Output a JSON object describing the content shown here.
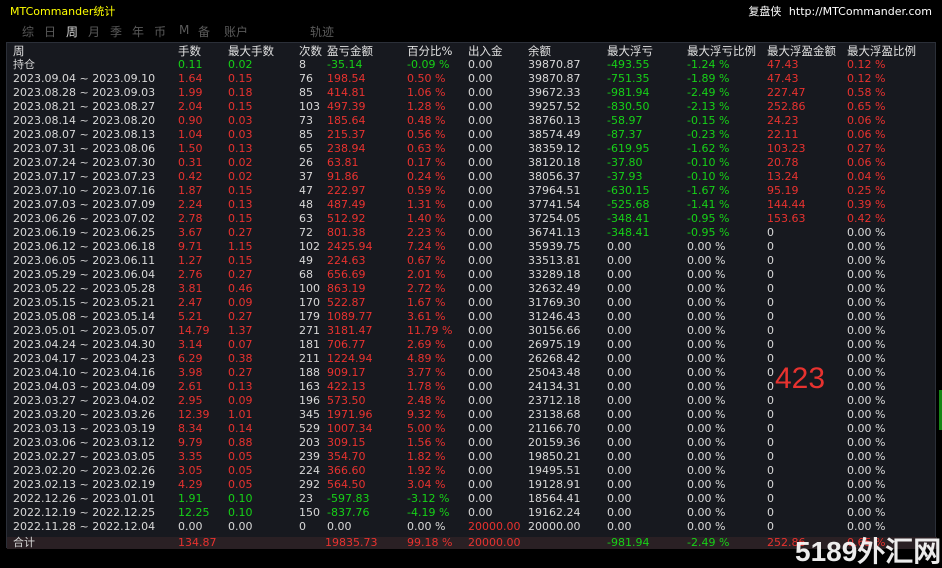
{
  "app": {
    "title": "MTCommander统计",
    "brand_label": "复盘侠",
    "brand_url": "http://MTCommander.com"
  },
  "tabs": [
    {
      "label": "综",
      "active": false
    },
    {
      "label": "日",
      "active": false
    },
    {
      "label": "周",
      "active": true
    },
    {
      "label": "月",
      "active": false
    },
    {
      "label": "季",
      "active": false
    },
    {
      "label": "年",
      "active": false
    },
    {
      "label": "币",
      "active": false
    },
    {
      "label": "M",
      "active": false
    },
    {
      "label": "备",
      "active": false
    },
    {
      "label": "账户",
      "active": false
    },
    {
      "label": "轨迹",
      "active": false
    }
  ],
  "columns": [
    "周",
    "手数",
    "最大手数",
    "次数",
    "盈亏金额",
    "百分比%",
    "出入金",
    "余额",
    "最大浮亏",
    "最大浮亏比例",
    "最大浮盈金额",
    "最大浮盈比例"
  ],
  "rows": [
    {
      "tone": "green",
      "cells": [
        "持仓",
        "0.11",
        "0.02",
        "8",
        "-35.14",
        "-0.09 %",
        "0.00",
        "39870.87",
        "-493.55",
        "-1.24 %",
        "47.43",
        "0.12 %"
      ]
    },
    {
      "tone": "red",
      "cells": [
        "2023.09.04 ~ 2023.09.10",
        "1.64",
        "0.15",
        "76",
        "198.54",
        "0.50 %",
        "0.00",
        "39870.87",
        "-751.35",
        "-1.89 %",
        "47.43",
        "0.12 %"
      ]
    },
    {
      "tone": "red",
      "cells": [
        "2023.08.28 ~ 2023.09.03",
        "1.99",
        "0.18",
        "85",
        "414.81",
        "1.06 %",
        "0.00",
        "39672.33",
        "-981.94",
        "-2.49 %",
        "227.47",
        "0.58 %"
      ]
    },
    {
      "tone": "red",
      "cells": [
        "2023.08.21 ~ 2023.08.27",
        "2.04",
        "0.15",
        "103",
        "497.39",
        "1.28 %",
        "0.00",
        "39257.52",
        "-830.50",
        "-2.13 %",
        "252.86",
        "0.65 %"
      ]
    },
    {
      "tone": "red",
      "cells": [
        "2023.08.14 ~ 2023.08.20",
        "0.90",
        "0.03",
        "73",
        "185.64",
        "0.48 %",
        "0.00",
        "38760.13",
        "-58.97",
        "-0.15 %",
        "24.23",
        "0.06 %"
      ]
    },
    {
      "tone": "red",
      "cells": [
        "2023.08.07 ~ 2023.08.13",
        "1.04",
        "0.03",
        "85",
        "215.37",
        "0.56 %",
        "0.00",
        "38574.49",
        "-87.37",
        "-0.23 %",
        "22.11",
        "0.06 %"
      ]
    },
    {
      "tone": "red",
      "cells": [
        "2023.07.31 ~ 2023.08.06",
        "1.50",
        "0.13",
        "65",
        "238.94",
        "0.63 %",
        "0.00",
        "38359.12",
        "-619.95",
        "-1.62 %",
        "103.23",
        "0.27 %"
      ]
    },
    {
      "tone": "red",
      "cells": [
        "2023.07.24 ~ 2023.07.30",
        "0.31",
        "0.02",
        "26",
        "63.81",
        "0.17 %",
        "0.00",
        "38120.18",
        "-37.80",
        "-0.10 %",
        "20.78",
        "0.06 %"
      ]
    },
    {
      "tone": "red",
      "cells": [
        "2023.07.17 ~ 2023.07.23",
        "0.42",
        "0.02",
        "37",
        "91.86",
        "0.24 %",
        "0.00",
        "38056.37",
        "-37.93",
        "-0.10 %",
        "13.24",
        "0.04 %"
      ]
    },
    {
      "tone": "red",
      "cells": [
        "2023.07.10 ~ 2023.07.16",
        "1.87",
        "0.15",
        "47",
        "222.97",
        "0.59 %",
        "0.00",
        "37964.51",
        "-630.15",
        "-1.67 %",
        "95.19",
        "0.25 %"
      ]
    },
    {
      "tone": "red",
      "cells": [
        "2023.07.03 ~ 2023.07.09",
        "2.24",
        "0.13",
        "48",
        "487.49",
        "1.31 %",
        "0.00",
        "37741.54",
        "-525.68",
        "-1.41 %",
        "144.44",
        "0.39 %"
      ]
    },
    {
      "tone": "red",
      "cells": [
        "2023.06.26 ~ 2023.07.02",
        "2.78",
        "0.15",
        "63",
        "512.92",
        "1.40 %",
        "0.00",
        "37254.05",
        "-348.41",
        "-0.95 %",
        "153.63",
        "0.42 %"
      ]
    },
    {
      "tone": "red",
      "cells": [
        "2023.06.19 ~ 2023.06.25",
        "3.67",
        "0.27",
        "72",
        "801.38",
        "2.23 %",
        "0.00",
        "36741.13",
        "-348.41",
        "-0.95 %",
        "0",
        "0.00 %"
      ]
    },
    {
      "tone": "red",
      "cells": [
        "2023.06.12 ~ 2023.06.18",
        "9.71",
        "1.15",
        "102",
        "2425.94",
        "7.24 %",
        "0.00",
        "35939.75",
        "0.00",
        "0.00 %",
        "0",
        "0.00 %"
      ]
    },
    {
      "tone": "red",
      "cells": [
        "2023.06.05 ~ 2023.06.11",
        "1.27",
        "0.15",
        "49",
        "224.63",
        "0.67 %",
        "0.00",
        "33513.81",
        "0.00",
        "0.00 %",
        "0",
        "0.00 %"
      ]
    },
    {
      "tone": "red",
      "cells": [
        "2023.05.29 ~ 2023.06.04",
        "2.76",
        "0.27",
        "68",
        "656.69",
        "2.01 %",
        "0.00",
        "33289.18",
        "0.00",
        "0.00 %",
        "0",
        "0.00 %"
      ]
    },
    {
      "tone": "red",
      "cells": [
        "2023.05.22 ~ 2023.05.28",
        "3.81",
        "0.46",
        "100",
        "863.19",
        "2.72 %",
        "0.00",
        "32632.49",
        "0.00",
        "0.00 %",
        "0",
        "0.00 %"
      ]
    },
    {
      "tone": "red",
      "cells": [
        "2023.05.15 ~ 2023.05.21",
        "2.47",
        "0.09",
        "170",
        "522.87",
        "1.67 %",
        "0.00",
        "31769.30",
        "0.00",
        "0.00 %",
        "0",
        "0.00 %"
      ]
    },
    {
      "tone": "red",
      "cells": [
        "2023.05.08 ~ 2023.05.14",
        "5.21",
        "0.27",
        "179",
        "1089.77",
        "3.61 %",
        "0.00",
        "31246.43",
        "0.00",
        "0.00 %",
        "0",
        "0.00 %"
      ]
    },
    {
      "tone": "red",
      "cells": [
        "2023.05.01 ~ 2023.05.07",
        "14.79",
        "1.37",
        "271",
        "3181.47",
        "11.79 %",
        "0.00",
        "30156.66",
        "0.00",
        "0.00 %",
        "0",
        "0.00 %"
      ]
    },
    {
      "tone": "red",
      "cells": [
        "2023.04.24 ~ 2023.04.30",
        "3.14",
        "0.07",
        "181",
        "706.77",
        "2.69 %",
        "0.00",
        "26975.19",
        "0.00",
        "0.00 %",
        "0",
        "0.00 %"
      ]
    },
    {
      "tone": "red",
      "cells": [
        "2023.04.17 ~ 2023.04.23",
        "6.29",
        "0.38",
        "211",
        "1224.94",
        "4.89 %",
        "0.00",
        "26268.42",
        "0.00",
        "0.00 %",
        "0",
        "0.00 %"
      ]
    },
    {
      "tone": "red",
      "cells": [
        "2023.04.10 ~ 2023.04.16",
        "3.98",
        "0.27",
        "188",
        "909.17",
        "3.77 %",
        "0.00",
        "25043.48",
        "0.00",
        "0.00 %",
        "0",
        "0.00 %"
      ]
    },
    {
      "tone": "red",
      "cells": [
        "2023.04.03 ~ 2023.04.09",
        "2.61",
        "0.13",
        "163",
        "422.13",
        "1.78 %",
        "0.00",
        "24134.31",
        "0.00",
        "0.00 %",
        "0",
        "0.00 %"
      ]
    },
    {
      "tone": "red",
      "cells": [
        "2023.03.27 ~ 2023.04.02",
        "2.95",
        "0.09",
        "196",
        "573.50",
        "2.48 %",
        "0.00",
        "23712.18",
        "0.00",
        "0.00 %",
        "0",
        "0.00 %"
      ]
    },
    {
      "tone": "red",
      "cells": [
        "2023.03.20 ~ 2023.03.26",
        "12.39",
        "1.01",
        "345",
        "1971.96",
        "9.32 %",
        "0.00",
        "23138.68",
        "0.00",
        "0.00 %",
        "0",
        "0.00 %"
      ]
    },
    {
      "tone": "red",
      "cells": [
        "2023.03.13 ~ 2023.03.19",
        "8.34",
        "0.14",
        "529",
        "1007.34",
        "5.00 %",
        "0.00",
        "21166.70",
        "0.00",
        "0.00 %",
        "0",
        "0.00 %"
      ]
    },
    {
      "tone": "red",
      "cells": [
        "2023.03.06 ~ 2023.03.12",
        "9.79",
        "0.88",
        "203",
        "309.15",
        "1.56 %",
        "0.00",
        "20159.36",
        "0.00",
        "0.00 %",
        "0",
        "0.00 %"
      ]
    },
    {
      "tone": "red",
      "cells": [
        "2023.02.27 ~ 2023.03.05",
        "3.35",
        "0.05",
        "239",
        "354.70",
        "1.82 %",
        "0.00",
        "19850.21",
        "0.00",
        "0.00 %",
        "0",
        "0.00 %"
      ]
    },
    {
      "tone": "red",
      "cells": [
        "2023.02.20 ~ 2023.02.26",
        "3.05",
        "0.05",
        "224",
        "366.60",
        "1.92 %",
        "0.00",
        "19495.51",
        "0.00",
        "0.00 %",
        "0",
        "0.00 %"
      ]
    },
    {
      "tone": "red",
      "cells": [
        "2023.02.13 ~ 2023.02.19",
        "4.29",
        "0.05",
        "292",
        "564.50",
        "3.04 %",
        "0.00",
        "19128.91",
        "0.00",
        "0.00 %",
        "0",
        "0.00 %"
      ]
    },
    {
      "tone": "green",
      "cells": [
        "2022.12.26 ~ 2023.01.01",
        "1.91",
        "0.10",
        "23",
        "-597.83",
        "-3.12 %",
        "0.00",
        "18564.41",
        "0.00",
        "0.00 %",
        "0",
        "0.00 %"
      ]
    },
    {
      "tone": "green",
      "cells": [
        "2022.12.19 ~ 2022.12.25",
        "12.25",
        "0.10",
        "150",
        "-837.76",
        "-4.19 %",
        "0.00",
        "19162.24",
        "0.00",
        "0.00 %",
        "0",
        "0.00 %"
      ]
    },
    {
      "tone": "neutral",
      "cells": [
        "2022.11.28 ~ 2022.12.04",
        "0.00",
        "0.00",
        "0",
        "0.00",
        "0.00 %",
        "20000.00",
        "20000.00",
        "0.00",
        "0.00 %",
        "0",
        "0.00 %"
      ]
    }
  ],
  "total": {
    "label": "合计",
    "lots": "134.87",
    "pnl": "19835.73",
    "pct": "99.18 %",
    "deposit": "20000.00",
    "max_float_loss": "-981.94",
    "max_float_loss_pct": "-2.49 %",
    "max_float_profit": "252.86",
    "max_float_profit_pct": "0.65 %"
  },
  "overlay_number": "423",
  "watermark": "5189外汇网",
  "colors": {
    "background": "#17191f",
    "profit": "#e8322f",
    "loss": "#17d117",
    "title": "#ffff00"
  }
}
